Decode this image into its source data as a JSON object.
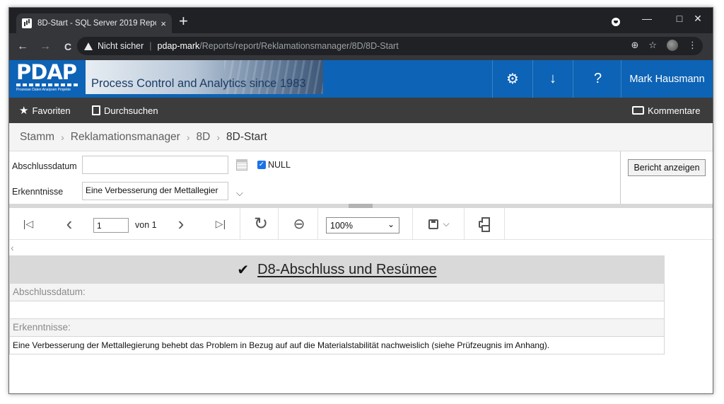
{
  "browser": {
    "tab_title": "8D-Start - SQL Server 2019 Repor",
    "tab_close": "×",
    "new_tab": "+",
    "security_label": "Nicht sicher",
    "url_separator": "|",
    "url_host": "pdap-mark",
    "url_path": "/Reports/report/Reklamationsmanager/8D/8D-Start",
    "icons": {
      "back": "←",
      "forward": "→",
      "reload": "C",
      "zoom": "⊕",
      "star": "☆",
      "menu": "⋮",
      "minimize": "—",
      "maximize": "□",
      "close": "✕"
    }
  },
  "header": {
    "logo_text": "PDAP",
    "logo_tagline": "Prozesse Daten Analysen Projekte",
    "banner_text": "Process Control and Analytics since 1983",
    "settings_icon": "⚙",
    "download_icon": "↓",
    "help_icon": "?",
    "user_name": "Mark Hausmann"
  },
  "toolbar": {
    "favorites_icon": "★",
    "favorites_label": "Favoriten",
    "browse_label": "Durchsuchen",
    "comments_label": "Kommentare"
  },
  "breadcrumb": {
    "items": [
      "Stamm",
      "Reklamationsmanager",
      "8D",
      "8D-Start"
    ],
    "separator": "›"
  },
  "params": {
    "abschluss_label": "Abschlussdatum",
    "abschluss_value": "",
    "null_checked_mark": "✓",
    "null_label": "NULL",
    "erkenntnisse_label": "Erkenntnisse",
    "erkenntnisse_value": "Eine Verbesserung der Mettallegier",
    "dropdown_chevron": "⌵",
    "run_button": "Bericht anzeigen"
  },
  "viewer": {
    "first_icon": "|◁",
    "prev_icon": "‹",
    "page_value": "1",
    "page_of": "von 1",
    "next_icon": "›",
    "last_icon": "▷|",
    "refresh_icon": "↻",
    "back_icon": "⊖",
    "zoom_value": "100%",
    "zoom_chevron": "⌄",
    "export_chevron": "⌵",
    "collapse_icon": "‹"
  },
  "report": {
    "title_check": "✔",
    "title": "D8-Abschluss und Resümee",
    "abschluss_label": "Abschlussdatum:",
    "abschluss_value": "",
    "erkenntnisse_label": "Erkenntnisse:",
    "erkenntnisse_value": "Eine Verbesserung der Mettallegierung behebt das Problem in Bezug auf auf die Materialstabilität nachweislich (siehe Prüfzeugnis im Anhang)."
  }
}
